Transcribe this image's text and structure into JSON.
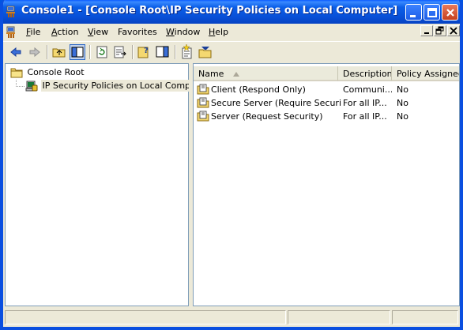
{
  "window": {
    "title": "Console1 - [Console Root\\IP Security Policies on Local Computer]",
    "accent": "#0a4fe0",
    "title_icon": "mmc-console-icon"
  },
  "menubar": {
    "items": [
      {
        "label": "File",
        "key": "F",
        "rest": "ile"
      },
      {
        "label": "Action",
        "key": "A",
        "rest": "ction"
      },
      {
        "label": "View",
        "key": "V",
        "rest": "iew"
      },
      {
        "label": "Favorites",
        "key": "",
        "rest": "Favorites"
      },
      {
        "label": "Window",
        "key": "W",
        "rest": "indow"
      },
      {
        "label": "Help",
        "key": "H",
        "rest": "elp"
      }
    ]
  },
  "toolbar": {
    "buttons": [
      "back-icon",
      "forward-icon",
      "up-one-level-icon",
      "show-hide-tree-icon",
      "refresh-icon",
      "export-list-icon",
      "help-icon",
      "show-hide-action-pane-icon",
      "new-policy-icon",
      "manage-filters-icon"
    ]
  },
  "tree": {
    "root": "Console Root",
    "child": "IP Security Policies on Local Computer"
  },
  "list": {
    "columns": [
      "Name",
      "Description",
      "Policy Assigned"
    ],
    "rows": [
      {
        "name": "Client (Respond Only)",
        "description": "Communi...",
        "assigned": "No"
      },
      {
        "name": "Secure Server (Require Security)",
        "description": "For all IP...",
        "assigned": "No"
      },
      {
        "name": "Server (Request Security)",
        "description": "For all IP...",
        "assigned": "No"
      }
    ]
  }
}
